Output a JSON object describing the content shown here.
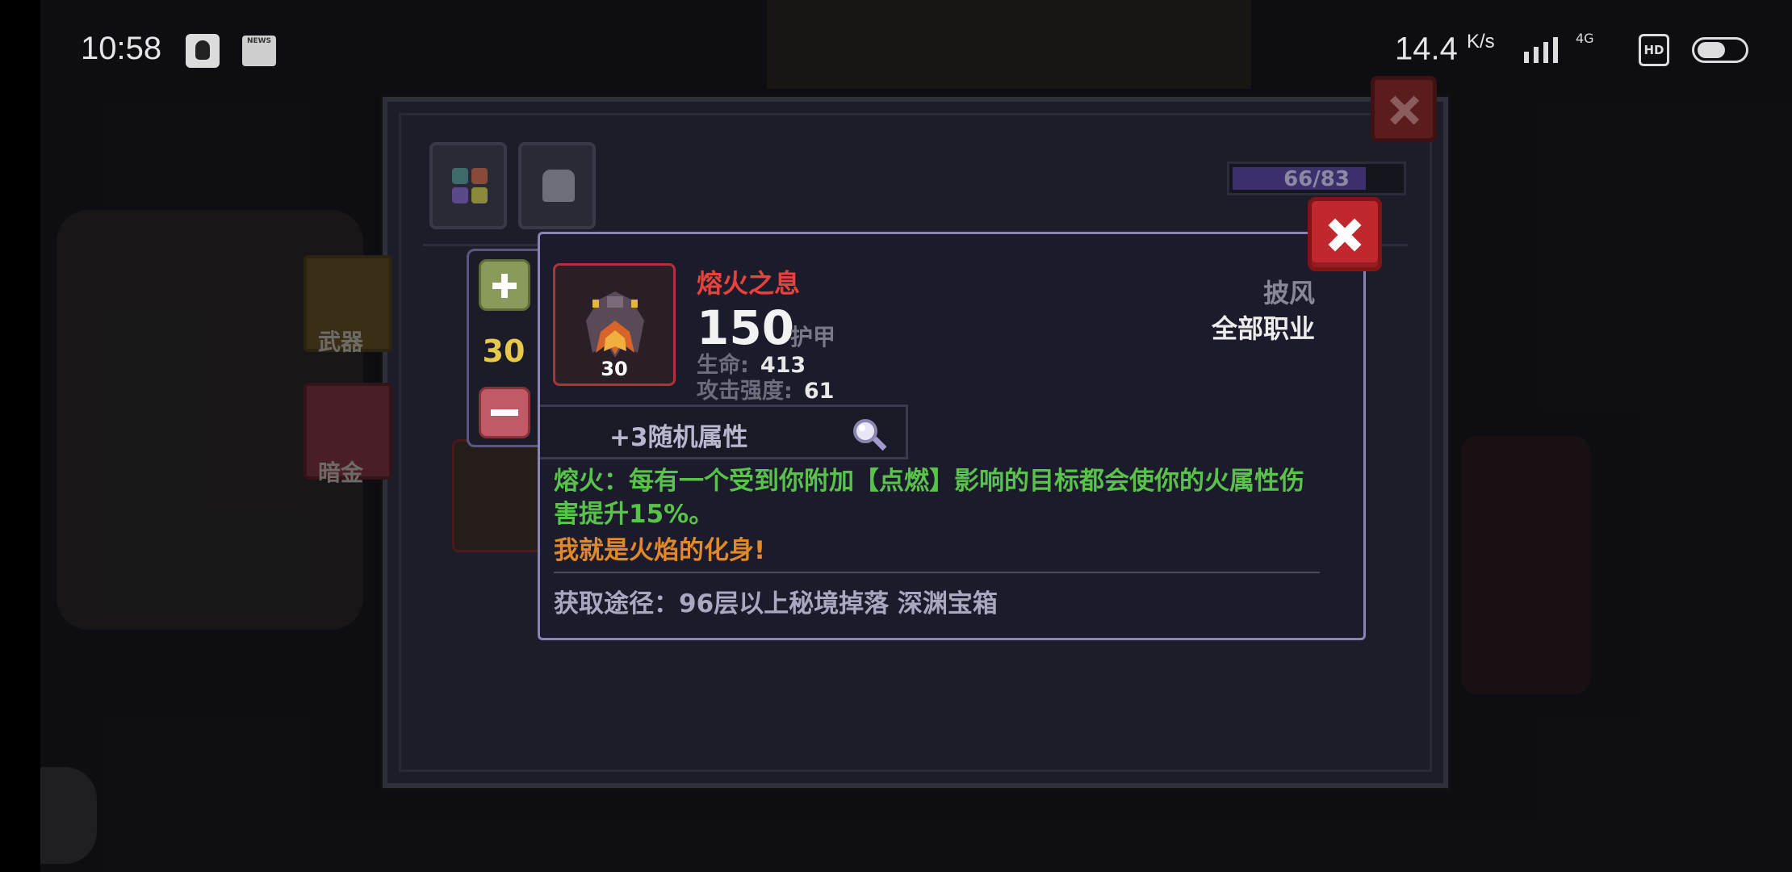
{
  "status_bar": {
    "time": "10:58",
    "news_label": "NEWS",
    "net_rate": "14.4",
    "net_rate_unit": "K/s",
    "signal_label": "4G",
    "hd_label": "HD"
  },
  "panel": {
    "progress_text": "66/83",
    "progress_fraction": 0.795,
    "side_items": [
      "武器",
      "暗金"
    ]
  },
  "stepper": {
    "quantity": "30"
  },
  "item": {
    "name": "熔火之息",
    "level": "30",
    "armor_value": "150",
    "armor_label": "护甲",
    "stats": [
      {
        "key": "生命:",
        "value": "413"
      },
      {
        "key": "攻击强度:",
        "value": "61"
      }
    ],
    "slot_type": "披风",
    "class_restriction": "全部职业",
    "random_attr": "+3随机属性",
    "description": "熔火：每有一个受到你附加【点燃】影响的目标都会使你的火属性伤害提升15%。",
    "flavor": "我就是火焰的化身!",
    "source": "获取途径：96层以上秘境掉落 深渊宝箱"
  },
  "colors": {
    "item_name": "#e8423c",
    "description": "#58c24a",
    "flavor": "#e0882a",
    "quantity": "#e8c84a",
    "close_button": "#c0282d"
  },
  "icons": [
    "close-icon",
    "plus-icon",
    "minus-icon",
    "magnifier-icon",
    "cloak-icon",
    "inventory-tab-icon",
    "bag-tab-icon"
  ]
}
